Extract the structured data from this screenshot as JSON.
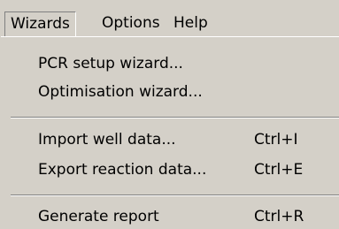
{
  "menubar": {
    "items": [
      {
        "label": "Wizards"
      },
      {
        "label": "Options"
      },
      {
        "label": "Help"
      }
    ]
  },
  "dropdown": {
    "items": [
      {
        "label": "PCR setup wizard...",
        "shortcut": ""
      },
      {
        "label": "Optimisation wizard...",
        "shortcut": ""
      },
      {
        "label": "Import well data...",
        "shortcut": "Ctrl+I"
      },
      {
        "label": "Export reaction data...",
        "shortcut": "Ctrl+E"
      },
      {
        "label": "Generate report",
        "shortcut": "Ctrl+R"
      }
    ]
  }
}
